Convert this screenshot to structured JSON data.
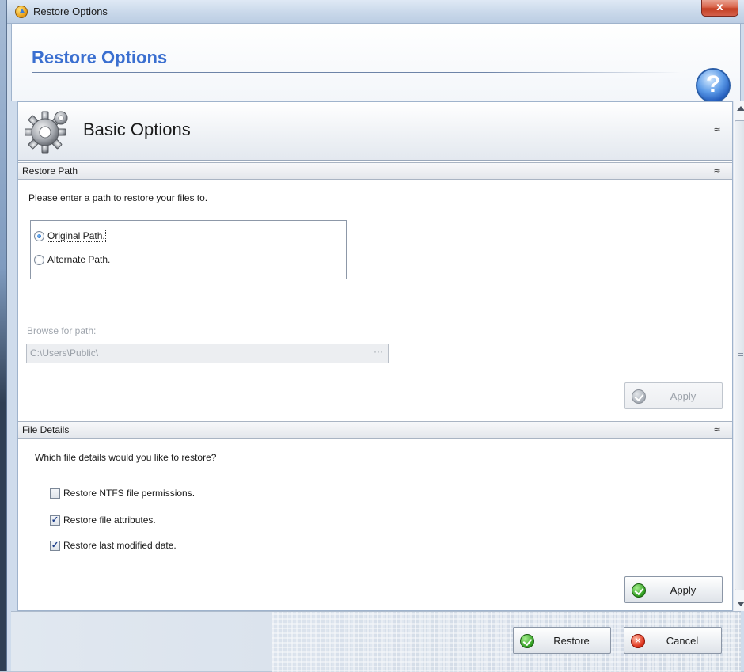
{
  "window": {
    "title": "Restore Options",
    "close_glyph": "x"
  },
  "header": {
    "title": "Restore Options",
    "help_glyph": "?"
  },
  "basic_options": {
    "title": "Basic Options",
    "collapse_glyph": "≈"
  },
  "restore_path": {
    "section_label": "Restore Path",
    "collapse_glyph": "≈",
    "prompt": "Please enter a path to restore your files to.",
    "options": [
      {
        "label": "Original Path.",
        "selected": true
      },
      {
        "label": "Alternate Path.",
        "selected": false
      }
    ],
    "browse_label": "Browse for path:",
    "path_value": "C:\\Users\\Public\\",
    "browse_glyph": "···",
    "apply_label": "Apply",
    "apply_enabled": false
  },
  "file_details": {
    "section_label": "File Details",
    "collapse_glyph": "≈",
    "prompt": "Which file details would you like to restore?",
    "options": [
      {
        "label": "Restore NTFS file permissions.",
        "checked": false
      },
      {
        "label": "Restore file attributes.",
        "checked": true
      },
      {
        "label": "Restore last modified date.",
        "checked": true
      }
    ],
    "apply_label": "Apply",
    "apply_enabled": true
  },
  "footer": {
    "restore_label": "Restore",
    "cancel_label": "Cancel"
  },
  "icons": {
    "app": "restore-app-icon",
    "help": "help-icon",
    "gear": "gear-icon",
    "ok": "check-icon",
    "cancel": "x-icon"
  },
  "colors": {
    "title_blue": "#3a6fd0",
    "close_red": "#c33f23",
    "ok_green": "#2f9d1f",
    "cancel_red": "#e0361f"
  }
}
